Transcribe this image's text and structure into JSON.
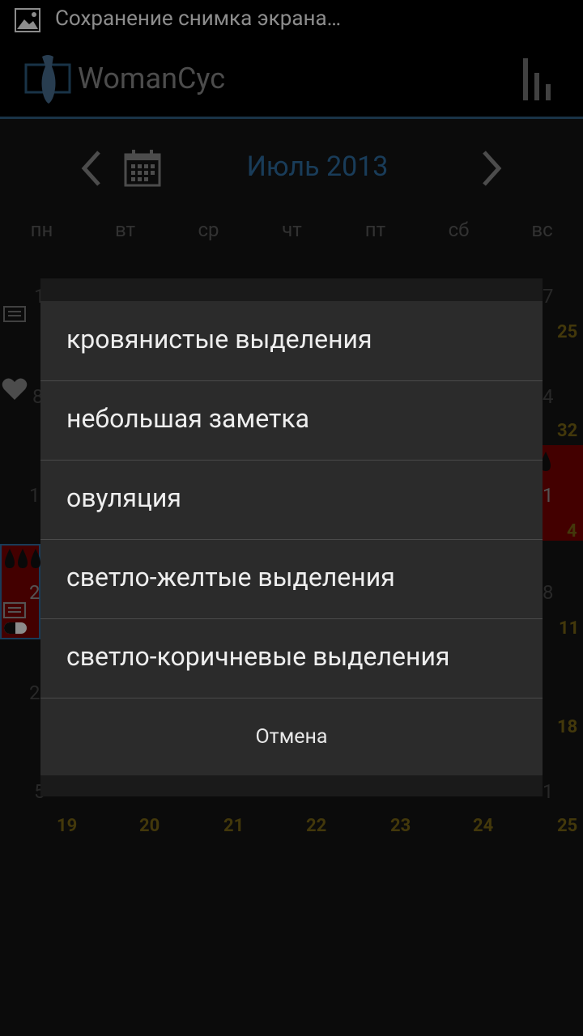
{
  "status_bar": {
    "text": "Сохранение снимка экрана…"
  },
  "action_bar": {
    "title": "WomanCyc"
  },
  "month_nav": {
    "title": "Июль 2013"
  },
  "weekdays": [
    "пн",
    "вт",
    "ср",
    "чт",
    "пт",
    "сб",
    "вс"
  ],
  "background_numbers": {
    "left_col": [
      "1",
      "8",
      "1",
      "2",
      "2",
      "5"
    ],
    "right_col": [
      "7",
      "4",
      "1",
      "8",
      "1"
    ]
  },
  "week_numbers": [
    "25",
    "32",
    "4",
    "11",
    "18"
  ],
  "bottom_week": [
    "19",
    "20",
    "21",
    "22",
    "23",
    "24",
    "25"
  ],
  "dialog": {
    "options": [
      "кровянистые выделения",
      "небольшая заметка",
      "овуляция",
      "светло-желтые выделения",
      "светло-коричневые выделения"
    ],
    "cancel": "Отмена"
  },
  "colors": {
    "accent": "#2f6ea3",
    "week_number": "#7a6614",
    "period_red": "#7a0000"
  }
}
